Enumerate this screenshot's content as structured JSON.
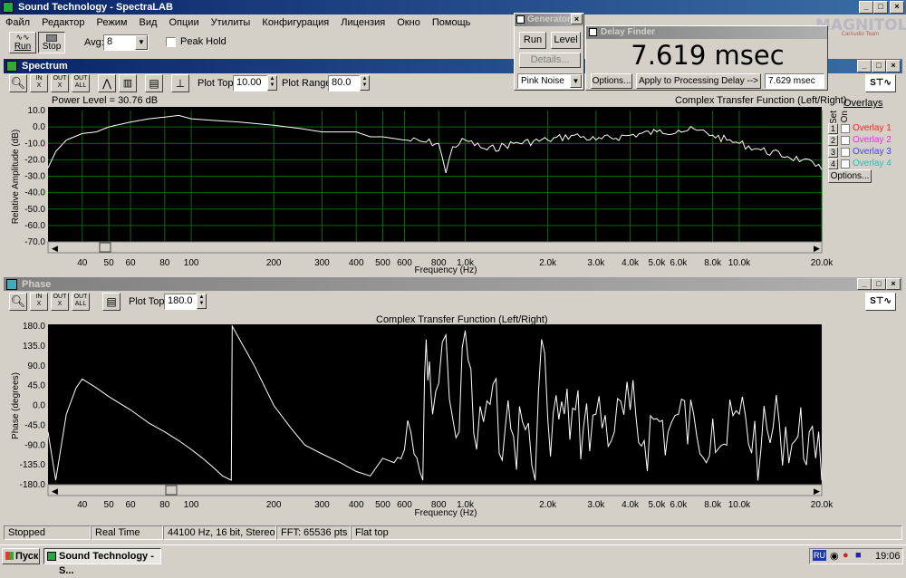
{
  "app": {
    "title": "Sound Technology - SpectraLAB",
    "menu": [
      "Файл",
      "Редактор",
      "Режим",
      "Вид",
      "Опции",
      "Утилиты",
      "Конфигурация",
      "Лицензия",
      "Окно",
      "Помощь"
    ],
    "watermark": "MAGNITOLA",
    "watermark_sub": "CarAudio Team"
  },
  "toolbar": {
    "run_label": "Run",
    "stop_label": "Stop",
    "avg_label": "Avg:",
    "avg_value": "8",
    "peak_hold_label": "Peak Hold"
  },
  "generator": {
    "title": "Generator",
    "run_label": "Run",
    "level_label": "Level",
    "details_label": "Details...",
    "signal_value": "Pink Noise"
  },
  "delay_finder": {
    "title": "Delay Finder",
    "value": "7.619 msec",
    "options_label": "Options...",
    "apply_label": "Apply to Processing Delay -->",
    "processing_delay": "7.629 msec"
  },
  "spectrum": {
    "title": "Spectrum",
    "plot_top_label": "Plot Top:",
    "plot_top_value": "10.00",
    "plot_range_label": "Plot Range:",
    "plot_range_value": "80.0",
    "power_level": "Power Level = 30.76 dB",
    "chart_title": "Complex Transfer Function (Left/Right)",
    "ylabel": "Relative Amplitude (dB)",
    "xlabel": "Frequency (Hz)",
    "yticks": [
      "10.0",
      "0.0",
      "-10.0",
      "-20.0",
      "-30.0",
      "-40.0",
      "-50.0",
      "-60.0",
      "-70.0"
    ],
    "overlays_label": "Overlays",
    "set_label": "Set",
    "on_label": "On",
    "overlays": [
      {
        "num": "1",
        "name": "Overlay 1",
        "color": "#ff2020"
      },
      {
        "num": "2",
        "name": "Overlay 2",
        "color": "#ff20ff"
      },
      {
        "num": "3",
        "name": "Overlay 3",
        "color": "#4040ff"
      },
      {
        "num": "4",
        "name": "Overlay 4",
        "color": "#20c0c0"
      }
    ],
    "options_label": "Options..."
  },
  "phase": {
    "title": "Phase",
    "plot_top_label": "Plot Top:",
    "plot_top_value": "180.0",
    "chart_title": "Complex Transfer Function (Left/Right)",
    "ylabel": "Phase (degrees)",
    "xlabel": "Frequency (Hz)",
    "yticks": [
      "180.0",
      "135.0",
      "90.0",
      "45.0",
      "0.0",
      "-45.0",
      "-90.0",
      "-135.0",
      "-180.0"
    ]
  },
  "xticks": [
    "40",
    "50",
    "60",
    "80",
    "100",
    "200",
    "300",
    "400",
    "500",
    "600",
    "800",
    "1.0k",
    "2.0k",
    "3.0k",
    "4.0k",
    "5.0k",
    "6.0k",
    "8.0k",
    "10.0k",
    "20.0k"
  ],
  "status": {
    "state": "Stopped",
    "mode": "Real Time",
    "format": "44100 Hz, 16 bit, Stereo",
    "fft": "FFT: 65536 pts",
    "window": "Flat top"
  },
  "taskbar": {
    "start_label": "Пуск",
    "task_label": "Sound Technology - S...",
    "lang": "RU",
    "clock": "19:06"
  },
  "chart_data": [
    {
      "type": "line",
      "title": "Complex Transfer Function (Left/Right)",
      "xlabel": "Frequency (Hz)",
      "ylabel": "Relative Amplitude (dB)",
      "x_scale": "log",
      "xlim": [
        30,
        20000
      ],
      "ylim": [
        -70,
        10
      ],
      "grid": true,
      "series": [
        {
          "x": [
            30,
            32,
            35,
            40,
            45,
            50,
            60,
            70,
            80,
            90,
            100,
            120,
            150,
            200,
            250,
            300,
            400,
            450,
            500,
            600,
            700,
            800,
            850,
            900,
            1000,
            1200,
            1500,
            2000,
            2500,
            3000,
            4000,
            5000,
            6000,
            7000,
            8000,
            9000,
            10000,
            12000,
            15000,
            17000,
            19000,
            20000
          ],
          "y": [
            -25,
            -15,
            -8,
            -4,
            -3,
            0,
            3,
            5,
            6,
            7,
            5,
            4,
            3,
            1,
            -1,
            -3,
            -3,
            -6,
            -6,
            -8,
            -9,
            -10,
            -28,
            -12,
            -8,
            -14,
            -10,
            -8,
            -5,
            -8,
            -5,
            -3,
            -2,
            -2,
            -5,
            -8,
            -10,
            -14,
            -18,
            -20,
            -24,
            -26
          ]
        }
      ]
    },
    {
      "type": "line",
      "title": "Complex Transfer Function (Left/Right)",
      "xlabel": "Frequency (Hz)",
      "ylabel": "Phase (degrees)",
      "x_scale": "log",
      "xlim": [
        30,
        20000
      ],
      "ylim": [
        -180,
        180
      ],
      "grid": false,
      "series": [
        {
          "x": [
            30,
            32,
            35,
            38,
            40,
            45,
            50,
            60,
            70,
            80,
            90,
            100,
            110,
            120,
            130,
            140,
            141,
            150,
            170,
            200,
            230,
            260,
            300,
            350,
            400,
            450,
            500,
            550,
            600,
            650,
            700,
            720,
            740,
            760,
            800,
            850,
            900,
            950,
            1000,
            1100,
            1200,
            1400,
            1500,
            1700,
            1800,
            1900,
            2000,
            2300,
            2700,
            3000,
            3500,
            4000,
            4500,
            5000,
            5500,
            6000,
            7000,
            8000,
            9000,
            10000,
            12000,
            14000,
            16000,
            18000,
            19000,
            20000
          ],
          "y": [
            -60,
            -170,
            -20,
            40,
            60,
            40,
            20,
            -10,
            -40,
            -60,
            -80,
            -100,
            -120,
            -140,
            -160,
            -170,
            180,
            150,
            90,
            0,
            -50,
            -90,
            -110,
            -130,
            -150,
            -160,
            -120,
            -130,
            -100,
            -110,
            -170,
            150,
            100,
            -20,
            50,
            160,
            -30,
            -60,
            170,
            -100,
            10,
            -50,
            -70,
            -40,
            -170,
            150,
            -30,
            -20,
            -50,
            -20,
            -60,
            -10,
            -80,
            -30,
            -60,
            -20,
            -70,
            -30,
            -90,
            -20,
            -100,
            -40,
            -80,
            -60,
            -120,
            -170
          ]
        }
      ]
    }
  ]
}
